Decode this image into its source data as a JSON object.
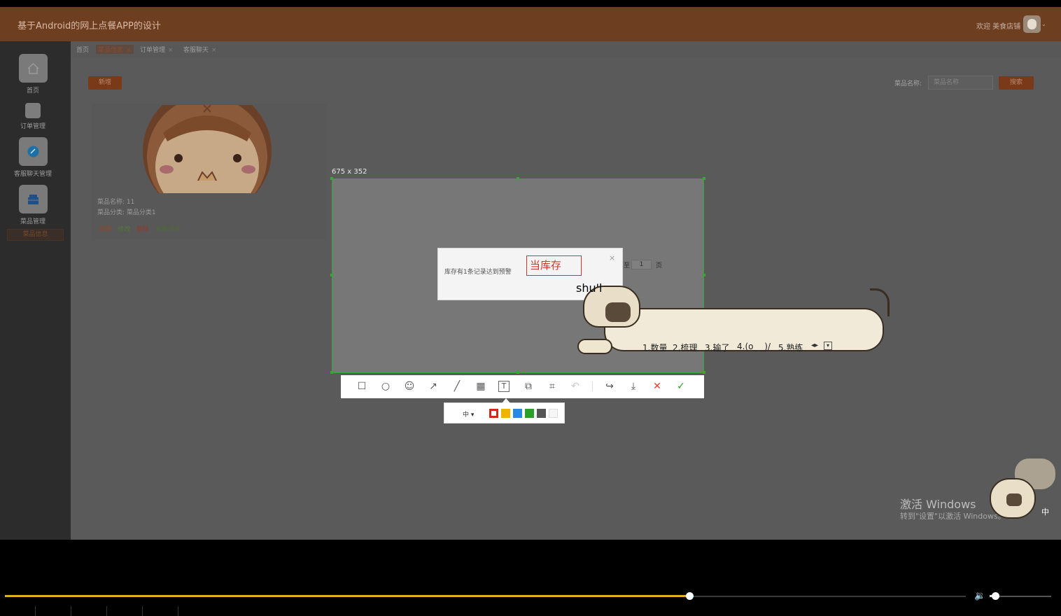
{
  "header": {
    "title": "基于Android的网上点餐APP的设计",
    "welcome": "欢迎 美食店铺",
    "caret": "⌄"
  },
  "sidebar": {
    "items": [
      {
        "label": "首页",
        "icon": "home-icon"
      },
      {
        "label": "订单管理",
        "icon": "order-icon"
      },
      {
        "label": "客服聊天管理",
        "icon": "chat-icon"
      },
      {
        "label": "菜品管理",
        "icon": "dish-icon"
      }
    ],
    "sub_item": "菜品信息"
  },
  "tabs": [
    {
      "label": "首页",
      "close": ""
    },
    {
      "label": "菜品信息",
      "close": "×"
    },
    {
      "label": "订单管理",
      "close": "×"
    },
    {
      "label": "客服聊天",
      "close": "×"
    }
  ],
  "toolbar": {
    "add_label": "新增",
    "search_label": "菜品名称:",
    "search_placeholder": "菜品名称",
    "search_button": "搜索"
  },
  "card": {
    "name_line": "菜品名称:  11",
    "category_line": "菜品分类:  菜品分类1",
    "actions": [
      {
        "label": "详情",
        "color": "#8e4a2a"
      },
      {
        "label": "修改",
        "color": "#4f7a3a"
      },
      {
        "label": "删除",
        "color": "#8e3a2a"
      },
      {
        "label": "查看评论",
        "color": "#4f6a3a"
      }
    ]
  },
  "capture": {
    "size_label": "675 x 352",
    "border_color": "#3aa63a"
  },
  "dialog": {
    "message": "库存有1条记录达到预警",
    "close": "×",
    "text_input": "当库存"
  },
  "pager": {
    "prefix": "至",
    "page": "1",
    "suffix": "页"
  },
  "capture_tools": {
    "tools": [
      {
        "name": "rectangle-icon",
        "glyph": "☐"
      },
      {
        "name": "ellipse-icon",
        "glyph": "○"
      },
      {
        "name": "emoji-icon",
        "glyph": "☺"
      },
      {
        "name": "arrow-icon",
        "glyph": "↗"
      },
      {
        "name": "line-icon",
        "glyph": "╱"
      },
      {
        "name": "mosaic-icon",
        "glyph": "▦"
      },
      {
        "name": "text-icon",
        "glyph": "T"
      },
      {
        "name": "sequence-icon",
        "glyph": "⧉"
      },
      {
        "name": "ocr-icon",
        "glyph": "⌗"
      },
      {
        "name": "undo-icon",
        "glyph": "↶"
      },
      {
        "name": "share-icon",
        "glyph": "↪"
      },
      {
        "name": "save-icon",
        "glyph": "⤓"
      },
      {
        "name": "cancel-icon",
        "glyph": "✕"
      },
      {
        "name": "confirm-icon",
        "glyph": "✓"
      }
    ],
    "size_option": "中 ▾",
    "colors": [
      "#d12a1a",
      "#f0b400",
      "#2a8ae0",
      "#2aa02a",
      "#555555",
      "#f5f5f5"
    ]
  },
  "ime": {
    "input": "shu'l",
    "candidates": [
      "1.数量",
      "2.梳理",
      "3.输了",
      "4.(o_ _)/",
      "5.熟练"
    ],
    "nav": "◂▸",
    "menu": "▾",
    "mode_label": "中"
  },
  "watermark": {
    "line1": "激活 Windows",
    "line2": "转到\"设置\"以激活 Windows。"
  },
  "player": {
    "progress": 0.7123,
    "volume": 0.09,
    "progress_color": "#e0b020",
    "volume_glyph": "🔉"
  }
}
